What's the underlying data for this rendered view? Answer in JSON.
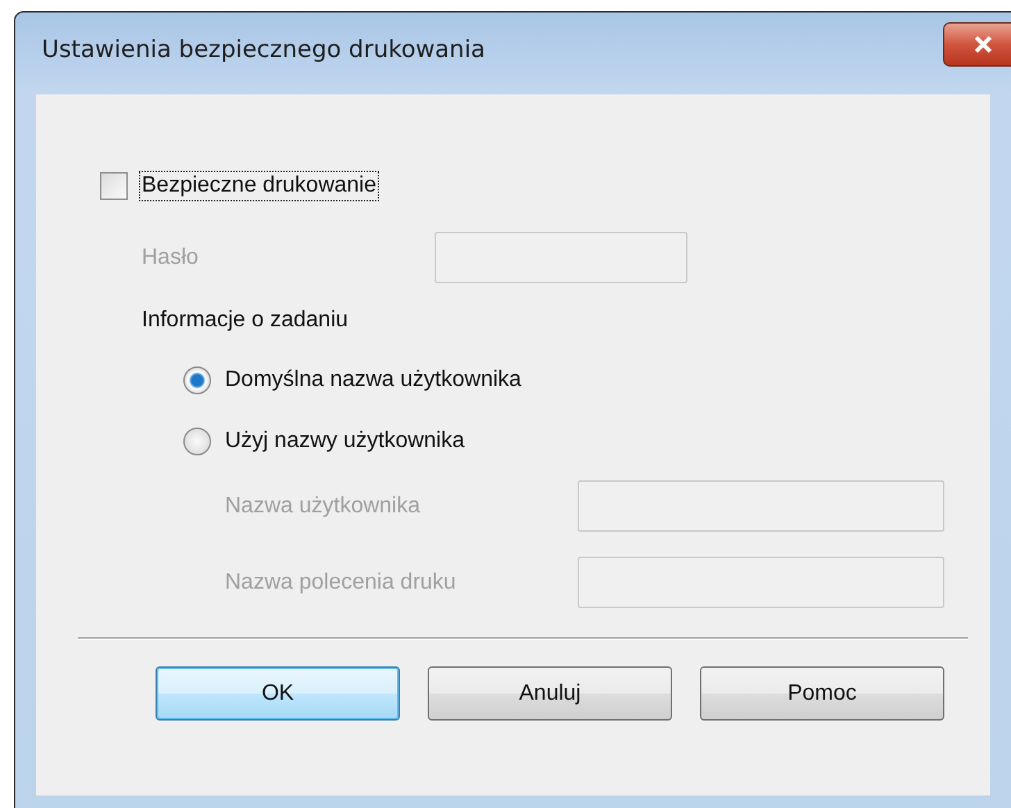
{
  "window": {
    "title": "Ustawienia bezpiecznego drukowania"
  },
  "secure_print": {
    "label": "Bezpieczne drukowanie",
    "checked": false,
    "focused": true
  },
  "password": {
    "label": "Hasło",
    "disabled": true
  },
  "job_info": {
    "heading": "Informacje o zadaniu",
    "options": [
      {
        "label": "Domyślna nazwa użytkownika",
        "selected": true
      },
      {
        "label": "Użyj nazwy użytkownika",
        "selected": false
      }
    ],
    "fields": [
      {
        "label": "Nazwa użytkownika",
        "disabled": true
      },
      {
        "label": "Nazwa polecenia druku",
        "disabled": true
      }
    ]
  },
  "buttons": [
    {
      "label": "OK",
      "default": true
    },
    {
      "label": "Anuluj",
      "default": false
    },
    {
      "label": "Pomoc",
      "default": false
    }
  ]
}
